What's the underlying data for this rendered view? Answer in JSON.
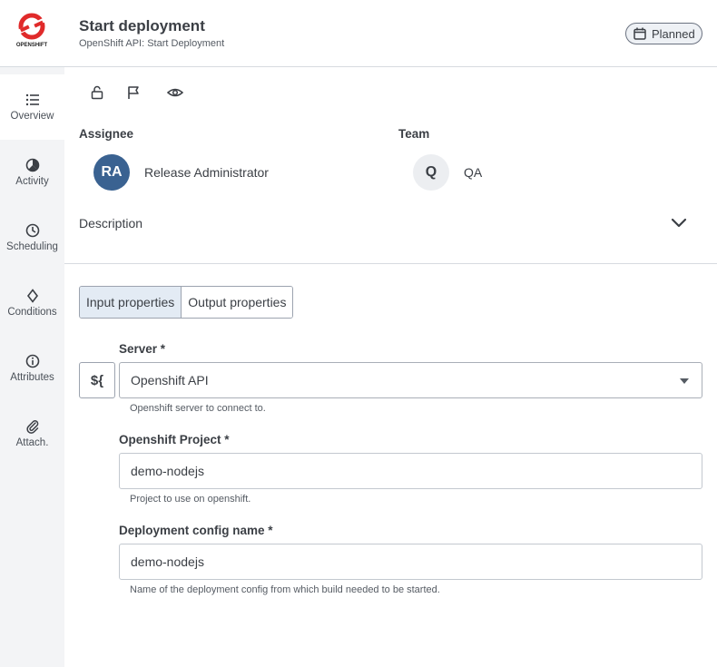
{
  "header": {
    "title": "Start deployment",
    "subtitle": "OpenShift API: Start Deployment",
    "status": "Planned",
    "logo_text": "OPENSHIFT",
    "logo_icon": "openshift-logo",
    "status_icon": "calendar-icon"
  },
  "sidebar": {
    "items": [
      {
        "label": "Overview",
        "icon": "list-icon",
        "active": true
      },
      {
        "label": "Activity",
        "icon": "pie-chart-icon"
      },
      {
        "label": "Scheduling",
        "icon": "clock-icon"
      },
      {
        "label": "Conditions",
        "icon": "diamond-icon"
      },
      {
        "label": "Attributes",
        "icon": "info-icon"
      },
      {
        "label": "Attach.",
        "icon": "paperclip-icon"
      }
    ]
  },
  "toolbar": {
    "icons": [
      "unlock-icon",
      "flag-icon",
      "eye-icon"
    ]
  },
  "assignee": {
    "heading": "Assignee",
    "initials": "RA",
    "name": "Release Administrator"
  },
  "team": {
    "heading": "Team",
    "initial": "Q",
    "name": "QA"
  },
  "description": {
    "label": "Description",
    "icon": "chevron-down-icon"
  },
  "tabs": {
    "input": "Input properties",
    "output": "Output properties",
    "active": "input"
  },
  "fields": {
    "variable_button": "${",
    "server": {
      "label": "Server *",
      "value": "Openshift API",
      "helper": "Openshift server to connect to."
    },
    "project": {
      "label": "Openshift Project *",
      "value": "demo-nodejs",
      "helper": "Project to use on openshift."
    },
    "deployment": {
      "label": "Deployment config name *",
      "value": "demo-nodejs",
      "helper": "Name of the deployment config from which build needed to be started."
    }
  },
  "colors": {
    "accent": "#3a6291",
    "logo_red": "#e02a2a",
    "sidebar_bg": "#f3f4f6",
    "tab_active_bg": "#e3ebf4"
  }
}
